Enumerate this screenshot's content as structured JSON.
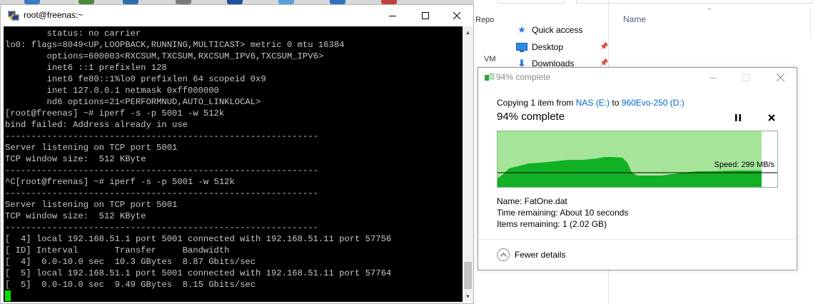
{
  "terminal": {
    "title": "root@freenas:~",
    "lines": [
      "        status: no carrier",
      "lo0: flags=8049<UP,LOOPBACK,RUNNING,MULTICAST> metric 0 mtu 16384",
      "        options=600003<RXCSUM,TXCSUM,RXCSUM_IPV6,TXCSUM_IPV6>",
      "        inet6 ::1 prefixlen 128",
      "        inet6 fe80::1%lo0 prefixlen 64 scopeid 0x9",
      "        inet 127.0.0.1 netmask 0xff000000",
      "        nd6 options=21<PERFORMNUD,AUTO_LINKLOCAL>",
      "[root@freenas] ~# iperf -s -p 5001 -w 512k",
      "bind failed: Address already in use",
      "------------------------------------------------------------",
      "Server listening on TCP port 5001",
      "TCP window size:  512 KByte",
      "------------------------------------------------------------",
      "^C[root@freenas] ~# iperf -s -p 5001 -w 512k",
      "------------------------------------------------------------",
      "Server listening on TCP port 5001",
      "TCP window size:  512 KByte",
      "------------------------------------------------------------",
      "[  4] local 192.168.51.1 port 5001 connected with 192.168.51.11 port 57756",
      "[ ID] Interval       Transfer     Bandwidth",
      "[  4]  0.0-10.0 sec  10.3 GBytes  8.87 Gbits/sec",
      "[  5] local 192.168.51.1 port 5001 connected with 192.168.51.11 port 57764",
      "[  5]  0.0-10.0 sec  9.49 GBytes  8.15 Gbits/sec"
    ],
    "minimize_icon": "minimize-icon",
    "maximize_icon": "maximize-icon",
    "close_icon": "close-icon"
  },
  "explorer": {
    "fragments": {
      "repo": "Repo",
      "vm": "VM"
    },
    "column_name": "Name",
    "nav_items": [
      {
        "label": "Quick access",
        "icon": "star-icon"
      },
      {
        "label": "Desktop",
        "icon": "desktop-icon"
      },
      {
        "label": "Downloads",
        "icon": "download-icon"
      }
    ]
  },
  "copy_dialog": {
    "title": "94% complete",
    "desc_prefix": "Copying 1 item from ",
    "source": "NAS (E:)",
    "desc_middle": " to ",
    "destination": "960Evo-250 (D:)",
    "heading": "94% complete",
    "progress_fraction": 0.94,
    "speed_label": "Speed: 299 MB/s",
    "name_line": "Name:  FatOne.dat",
    "time_line": "Time remaining:  About 10 seconds",
    "items_line": "Items remaining:  1 (2.02 GB)",
    "fewer_details": "Fewer details",
    "colors": {
      "graph_fill_light": "#a6e49a",
      "graph_fill_dark": "#12b024",
      "graph_border": "#8ab68a",
      "link": "#0066cc"
    }
  }
}
